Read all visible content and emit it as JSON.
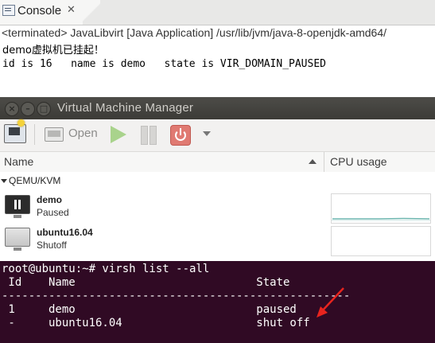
{
  "console": {
    "tab_label": "Console",
    "tab_close": "✕",
    "status": "<terminated> JavaLibvirt [Java Application] /usr/lib/jvm/java-8-openjdk-amd64/",
    "lines": [
      "demo虚拟机已挂起！",
      "id is 16   name is demo   state is VIR_DOMAIN_PAUSED"
    ]
  },
  "vmm": {
    "title": "Virtual Machine Manager",
    "window_buttons": [
      "×",
      "–",
      "□"
    ],
    "toolbar": {
      "new_icon": "new-vm-icon",
      "open_label": "Open",
      "run_icon": "play-icon",
      "pause_icon": "pause-icon",
      "shutdown_icon": "power-icon",
      "menu_icon": "chevron-down-icon"
    },
    "columns": {
      "name": "Name",
      "cpu": "CPU usage"
    },
    "group": "QEMU/KVM",
    "vms": [
      {
        "name": "demo",
        "status": "Paused"
      },
      {
        "name": "ubuntu16.04",
        "status": "Shutoff"
      }
    ]
  },
  "terminal": {
    "prompt_line": "root@ubuntu:~# virsh list --all",
    "header": " Id    Name                           State",
    "separator": "----------------------------------------------------",
    "rows": [
      " 1     demo                           paused",
      " -     ubuntu16.04                    shut off"
    ],
    "annotation_color": "#e8241e"
  },
  "colors": {
    "terminal_bg": "#300a24",
    "titlebar_bg": "#3c3b37",
    "cpu_graph_line": "#6fb7b0"
  }
}
